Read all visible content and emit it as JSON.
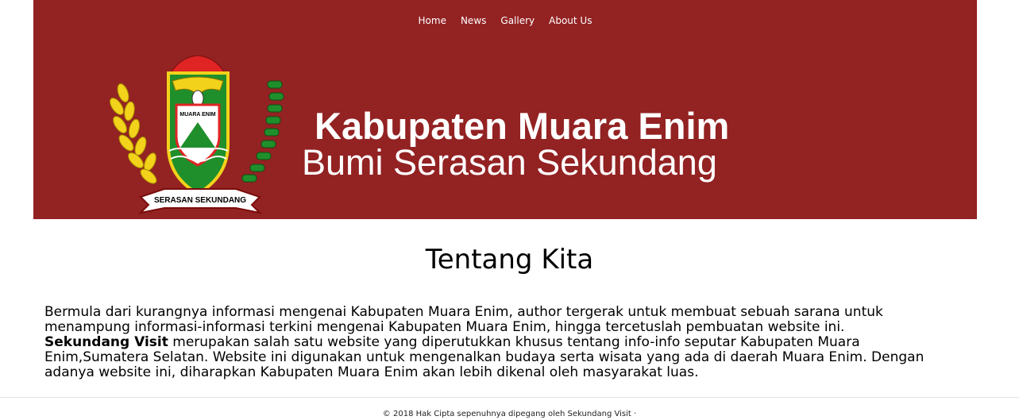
{
  "nav": {
    "items": [
      "Home",
      "News",
      "Gallery",
      "About Us"
    ]
  },
  "banner": {
    "title": "Kabupaten Muara Enim",
    "subtitle": "Bumi Serasan Sekundang",
    "emblem": {
      "top_text": "MUARA ENIM",
      "ribbon_text": "SERASAN SEKUNDANG"
    },
    "background_color": "#932223"
  },
  "main": {
    "heading": "Tentang Kita",
    "paragraph_1": "Bermula dari kurangnya informasi mengenai Kabupaten Muara Enim, author tergerak untuk membuat sebuah sarana untuk menampung informasi-informasi terkini mengenai Kabupaten Muara Enim, hingga tercetuslah pembuatan website ini.",
    "brand_name": "Sekundang Visit",
    "paragraph_2": " merupakan salah satu website yang diperutukkan khusus tentang info-info seputar Kabupaten Muara Enim,Sumatera Selatan. Website ini digunakan untuk mengenalkan budaya serta wisata yang ada di daerah Muara Enim. Dengan adanya website ini, diharapkan Kabupaten Muara Enim akan lebih dikenal oleh masyarakat luas."
  },
  "footer": {
    "text": "© 2018 Hak Cipta sepenuhnya dipegang oleh Sekundang Visit ·"
  }
}
